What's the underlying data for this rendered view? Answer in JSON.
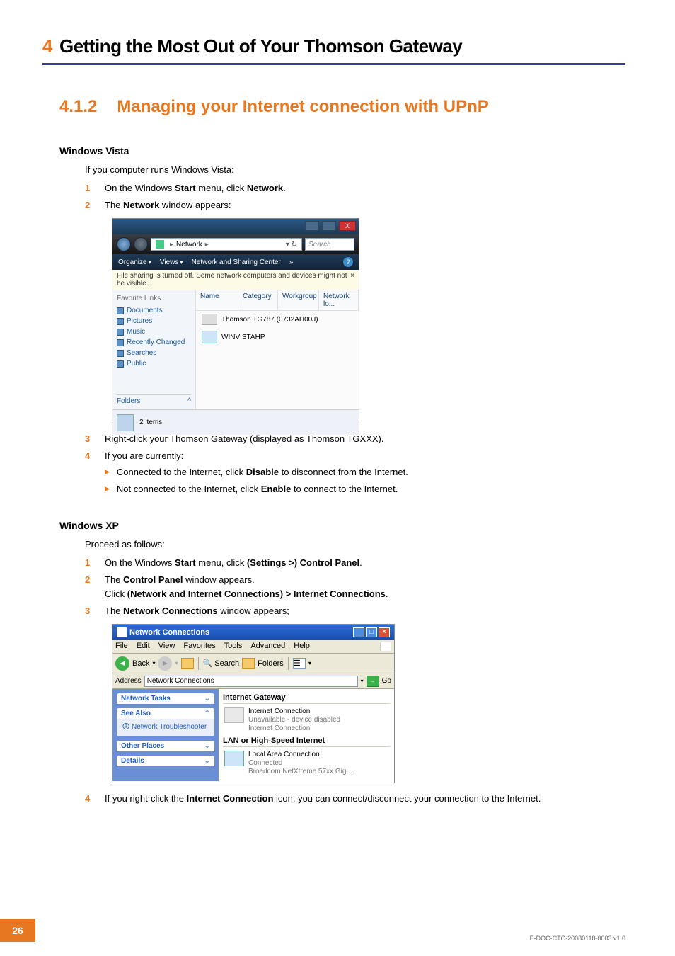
{
  "chapter": {
    "num": "4",
    "title": "Getting the Most Out of Your Thomson Gateway"
  },
  "section": {
    "num": "4.1.2",
    "title": "Managing your Internet connection with UPnP"
  },
  "vista": {
    "heading": "Windows Vista",
    "intro": "If you computer runs Windows Vista:",
    "steps": [
      {
        "n": "1",
        "pre": "On the Windows ",
        "b1": "Start",
        "mid": " menu, click ",
        "b2": "Network",
        "post": "."
      },
      {
        "n": "2",
        "pre": "The ",
        "b1": "Network",
        "post": " window appears:"
      }
    ],
    "step3": {
      "n": "3",
      "text": "Right-click your Thomson Gateway (displayed as Thomson TGXXX)."
    },
    "step4": {
      "n": "4",
      "text": "If you are currently:",
      "sub": [
        {
          "pre": "Connected to the Internet, click ",
          "b": "Disable",
          "post": " to disconnect from the Internet."
        },
        {
          "pre": "Not connected to the Internet, click ",
          "b": "Enable",
          "post": " to connect to the Internet."
        }
      ]
    },
    "shot": {
      "crumb_label": "Network",
      "crumb_arrow": "▸",
      "search_ph": "Search",
      "organize": "Organize",
      "views": "Views",
      "sharing": "Network and Sharing Center",
      "more": "»",
      "banner": "File sharing is turned off. Some network computers and devices might not be visible…",
      "banner_x": "×",
      "fav_label": "Favorite Links",
      "links": [
        "Documents",
        "Pictures",
        "Music",
        "Recently Changed",
        "Searches",
        "Public"
      ],
      "folders": "Folders",
      "caret": "^",
      "cols": [
        "Name",
        "Category",
        "Workgroup",
        "Network lo..."
      ],
      "item1": "Thomson TG787 (0732AH00J)",
      "item2": "WINVISTAHP",
      "status": "2 items",
      "close": "X"
    }
  },
  "xp": {
    "heading": "Windows XP",
    "intro": "Proceed as follows:",
    "steps": [
      {
        "n": "1",
        "pre": "On the Windows ",
        "b1": "Start",
        "mid": " menu, click ",
        "b2": "(Settings >) Control Panel",
        "post": "."
      },
      {
        "n": "2",
        "pre": "The ",
        "b1": "Control Panel",
        "mid": " window appears.",
        "line2pre": "Click ",
        "line2b": "(Network and Internet Connections) > Internet Connections",
        "line2post": "."
      },
      {
        "n": "3",
        "pre": "The ",
        "b1": "Network Connections",
        "post": " window appears;"
      }
    ],
    "step4": {
      "n": "4",
      "pre": "If you right-click the ",
      "b": "Internet Connection",
      "post": " icon, you can connect/disconnect your connection to the Internet."
    },
    "shot": {
      "title": "Network Connections",
      "menu": {
        "file": "File",
        "edit": "Edit",
        "view": "View",
        "fav": "Favorites",
        "tools": "Tools",
        "adv": "Advanced",
        "help": "Help"
      },
      "back": "Back",
      "search": "Search",
      "folders": "Folders",
      "addr_lbl": "Address",
      "addr_val": "Network Connections",
      "go": "Go",
      "panels": {
        "tasks": "Network Tasks",
        "seealso": "See Also",
        "trouble": "Network Troubleshooter",
        "other": "Other Places",
        "details": "Details"
      },
      "cat1": "Internet Gateway",
      "conn1": {
        "name": "Internet Connection",
        "l2": "Unavailable - device disabled",
        "l3": "Internet Connection"
      },
      "cat2": "LAN or High-Speed Internet",
      "conn2": {
        "name": "Local Area Connection",
        "l2": "Connected",
        "l3": "Broadcom NetXtreme 57xx Gig..."
      }
    }
  },
  "footer": {
    "page": "26",
    "docid": "E-DOC-CTC-20080118-0003 v1.0"
  }
}
